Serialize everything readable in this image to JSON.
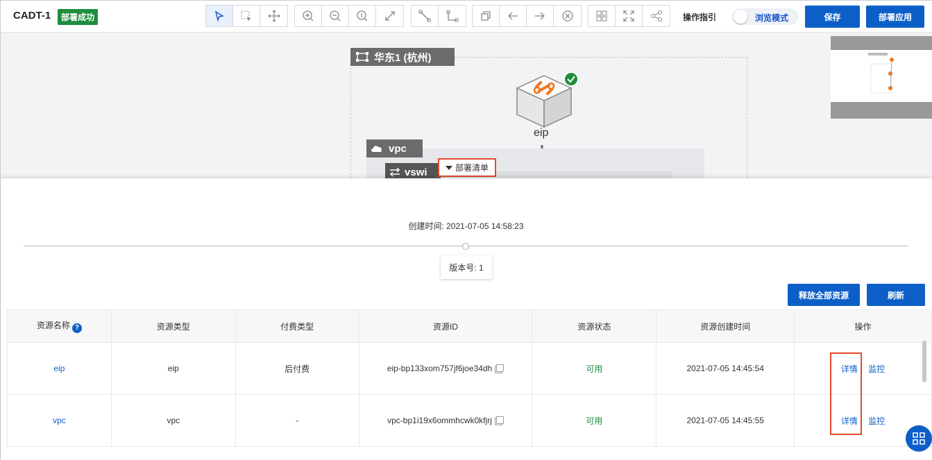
{
  "header": {
    "title": "CADT-1",
    "status_badge": "部署成功",
    "guide_label": "操作指引",
    "preview_mode_label": "浏览模式",
    "save_label": "保存",
    "deploy_label": "部署应用"
  },
  "toolbar_groups": [
    [
      "select-pointer-icon",
      "box-select-icon",
      "move-icon"
    ],
    [
      "zoom-in-icon",
      "zoom-out-icon",
      "zoom-reset-icon",
      "fit-screen-icon"
    ],
    [
      "straight-line-icon",
      "elbow-line-icon"
    ],
    [
      "copy-icon",
      "undo-icon",
      "redo-icon",
      "delete-icon"
    ],
    [
      "grid-icon",
      "fullscreen-icon",
      "share-icon"
    ]
  ],
  "canvas": {
    "region_label": "华东1 (杭州)",
    "vpc_label": "vpc",
    "vswitch_label": "vswi",
    "node_name": "eip",
    "deploy_list_tab": "部署清单"
  },
  "panel": {
    "created_text": "创建时间: 2021-07-05 14:58:23",
    "version_text": "版本号: 1",
    "release_all_label": "释放全部资源",
    "refresh_label": "刷新"
  },
  "table": {
    "headers": [
      "资源名称",
      "资源类型",
      "付费类型",
      "资源ID",
      "资源状态",
      "资源创建时间",
      "操作"
    ],
    "rows": [
      {
        "name": "eip",
        "type": "eip",
        "billing": "后付费",
        "id": "eip-bp133xom757jf6joe34dh",
        "status": "可用",
        "created": "2021-07-05 14:45:54",
        "detail": "详情",
        "monitor": "监控"
      },
      {
        "name": "vpc",
        "type": "vpc",
        "billing": "-",
        "id": "vpc-bp1i19x6ommhcwk0kfjrj",
        "status": "可用",
        "created": "2021-07-05 14:45:55",
        "detail": "详情",
        "monitor": "监控"
      }
    ]
  },
  "colors": {
    "primary": "#0d5fc8",
    "success": "#1e8e3e",
    "highlight": "#e14a2b"
  }
}
